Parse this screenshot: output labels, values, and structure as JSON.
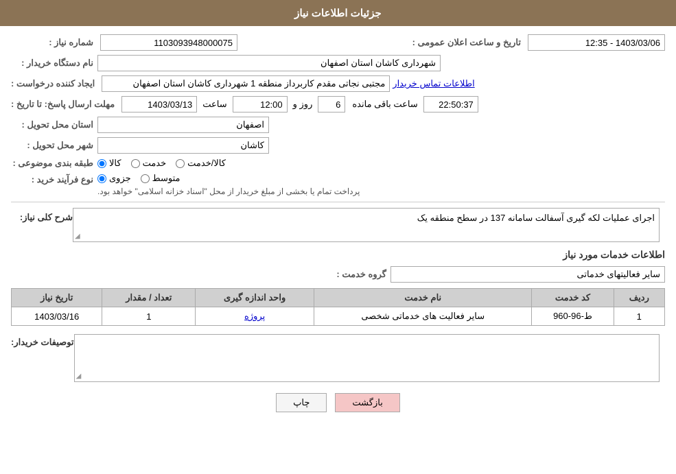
{
  "header": {
    "title": "جزئیات اطلاعات نیاز"
  },
  "fields": {
    "shomareNiaz_label": "شماره نیاز :",
    "shomareNiaz_value": "1103093948000075",
    "namDastgah_label": "نام دستگاه خریدار :",
    "namDastgah_value": "شهرداری کاشان استان اصفهان",
    "ijadKonande_label": "ایجاد کننده درخواست :",
    "ijadKonande_value": "مجتبی نجاتی مقدم کاربرداز منطقه 1 شهرداری کاشان استان اصفهان",
    "temaseKhardar_link": "اطلاعات تماس خریدار",
    "mohlatErsalPasakh_label": "مهلت ارسال پاسخ: تا تاریخ :",
    "mohlatTarikh_value": "1403/03/13",
    "mohlatSaat_label": "ساعت",
    "mohlatSaat_value": "12:00",
    "mohlatRoz_label": "روز و",
    "mohlatRoz_value": "6",
    "mohlatSaatBaqi_label": "ساعت باقی مانده",
    "mohlatSaatBaqi_value": "22:50:37",
    "tarikh_label": "تاریخ و ساعت اعلان عمومی :",
    "tarikh_value": "1403/03/06 - 12:35",
    "ostanTahvil_label": "استان محل تحویل :",
    "ostanTahvil_value": "اصفهان",
    "shahrTahvil_label": "شهر محل تحویل :",
    "shahrTahvil_value": "کاشان",
    "tabaqebandi_label": "طبقه بندی موضوعی :",
    "tabaqebandi_kala": "کالا",
    "tabaqebandi_khedmat": "خدمت",
    "tabaqebandi_kalaKhedmat": "کالا/خدمت",
    "noeFarayand_label": "نوع فرآیند خرید :",
    "noeFarayand_jozvi": "جزوی",
    "noeFarayand_motavaset": "متوسط",
    "noeFarayand_desc": "پرداخت تمام یا بخشی از مبلغ خریدار از محل \"اسناد خزانه اسلامی\" خواهد بود.",
    "sharhKolliNiaz_label": "شرح کلی نیاز:",
    "sharhKolliNiaz_value": "اجرای عملیات لکه گیری آسفالت سامانه 137 در سطح منطقه یک",
    "khadamatTitle": "اطلاعات خدمات مورد نیاز",
    "groupeKhedmat_label": "گروه خدمت :",
    "groupeKhedmat_value": "سایر فعالیتهای خدماتی",
    "table": {
      "headers": [
        "ردیف",
        "کد خدمت",
        "نام خدمت",
        "واحد اندازه گیری",
        "تعداد / مقدار",
        "تاریخ نیاز"
      ],
      "rows": [
        {
          "radif": "1",
          "kodKhedmat": "ط-96-960",
          "namKhedmat": "سایر فعالیت های خدماتی شخصی",
          "vahed": "پروژه",
          "tedad": "1",
          "tarikh": "1403/03/16"
        }
      ]
    },
    "tosifatKhardar_label": "توصیفات خریدار:",
    "buttons": {
      "print": "چاپ",
      "back": "بازگشت"
    }
  }
}
